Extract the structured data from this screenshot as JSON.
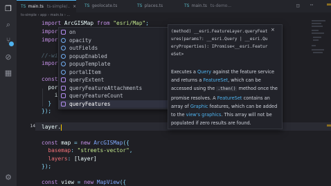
{
  "tabs": [
    {
      "ext": "TS",
      "name": "main.ts",
      "path": "ts-simple/..",
      "active": true
    },
    {
      "ext": "TS",
      "name": "geolocate.ts",
      "path": "",
      "active": false
    },
    {
      "ext": "TS",
      "name": "places.ts",
      "path": "",
      "active": false
    },
    {
      "ext": "TS",
      "name": "main.ts",
      "path": "ts-demo...",
      "active": false
    }
  ],
  "tab_close_glyph": "×",
  "breadcrumbs": "ts-simple  ›  app  ›  main.ts  ›  ...",
  "activity_icons": [
    "files-icon",
    "search-icon",
    "source-control-icon",
    "debug-icon",
    "extensions-icon",
    "settings-gear-icon"
  ],
  "line_numbers": [
    "",
    "",
    "",
    "",
    "",
    "",
    "",
    "",
    "",
    "",
    "",
    "",
    "",
    "14",
    "",
    "",
    "",
    "",
    "",
    "",
    "",
    ""
  ],
  "current_line": "14",
  "code_lines": {
    "l1": "import ArcGISMap from \"esri/Map\";",
    "l2": "import",
    "l3": "import",
    "l4": "",
    "l5": "//-wid",
    "l6": "import",
    "l7": "",
    "l8": "const",
    "l9": "  port",
    "l10": "    id",
    "l11": "  }",
    "l12": "});",
    "l14": "layer.",
    "l16": "const map = new ArcGISMap({",
    "l17": "  basemap: \"streets-vector\",",
    "l18": "  layers: [layer]",
    "l19": "});",
    "l21": "const view = new MapView({"
  },
  "suggestions": [
    {
      "label": "on",
      "kind": "method"
    },
    {
      "label": "opacity",
      "kind": "field"
    },
    {
      "label": "outFields",
      "kind": "field"
    },
    {
      "label": "popupEnabled",
      "kind": "field"
    },
    {
      "label": "popupTemplate",
      "kind": "field"
    },
    {
      "label": "portalItem",
      "kind": "field"
    },
    {
      "label": "queryExtent",
      "kind": "method"
    },
    {
      "label": "queryFeatureAttachments",
      "kind": "method"
    },
    {
      "label": "queryFeatureCount",
      "kind": "method"
    },
    {
      "label": "queryFeatures",
      "kind": "method"
    }
  ],
  "selected_suggestion": "queryFeatures",
  "doc": {
    "signature": "(method) __esri.FeatureLayer.queryFeatures(params?: __esri.Query | __esri.QueryProperties): IPromise<__esri.FeatureSet>",
    "close_glyph": "×",
    "body": {
      "p1": "Executes a ",
      "link_query": "Query",
      "p2": " against the feature service and returns a ",
      "link_featureset": "FeatureSet",
      "p3": ", which can be accessed using the ",
      "code_then": ".then()",
      "p4": " method once the promise resolves. A ",
      "link_featureset2": "FeatureSet",
      "p5": " contains an array of ",
      "link_graphic": "Graphic",
      "p6": " features, which can be added to the ",
      "link_graphics": "view's graphics",
      "p7": ". This array will not be populated if zero results are found."
    }
  },
  "colors": {
    "editor_bg": "#1f1f24",
    "accent": "#4fb3ef",
    "keyword": "#c792ea",
    "string": "#c3e88d",
    "function": "#82aaff"
  }
}
